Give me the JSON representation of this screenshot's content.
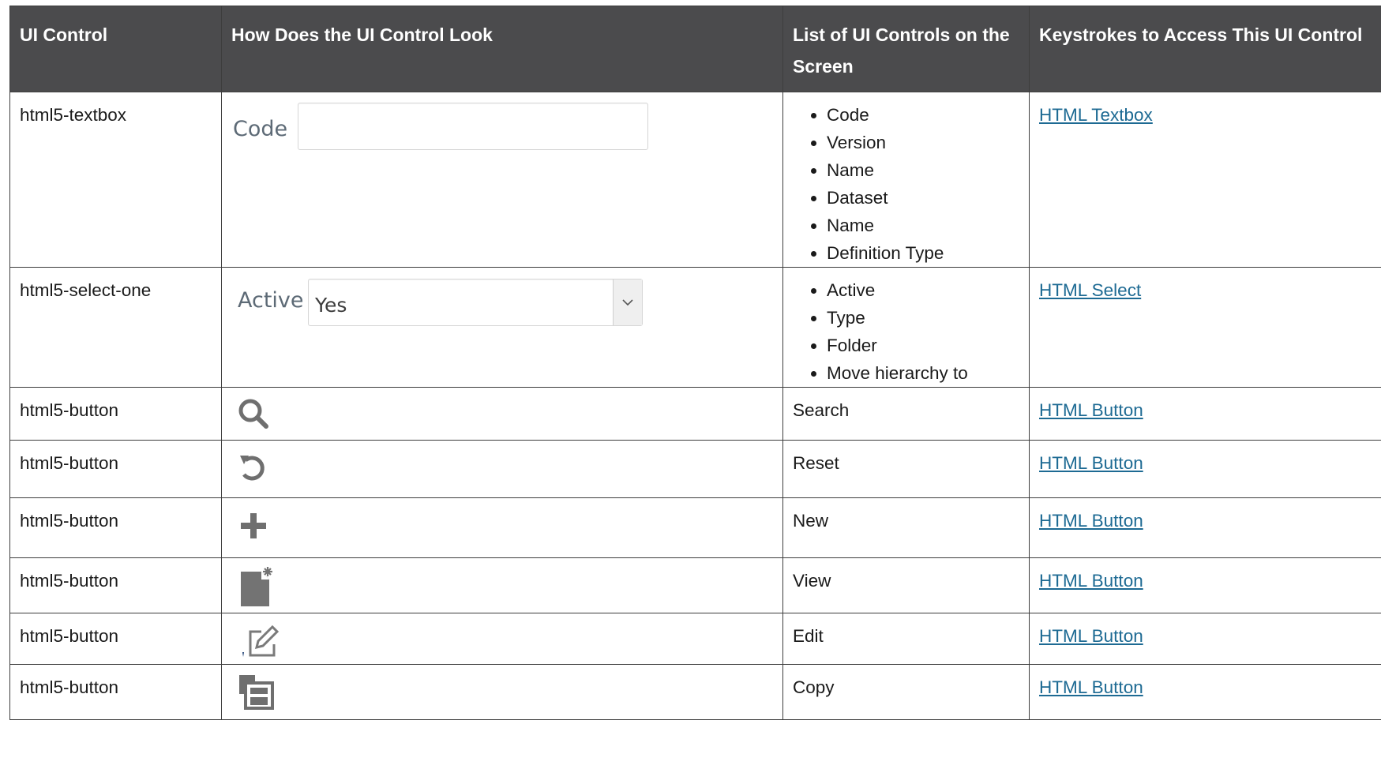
{
  "headers": {
    "ui_control": "UI Control",
    "looks": "How Does the UI Control Look",
    "controls_list": "List of UI Controls on the Screen",
    "keystrokes": "Keystrokes to Access This UI Control"
  },
  "rows": [
    {
      "ui_control": "html5-textbox",
      "mock": {
        "label": "Code",
        "value": ""
      },
      "controls": [
        "Code",
        "Version",
        "Name",
        "Dataset",
        "Name",
        "Definition Type"
      ],
      "link": "HTML Textbox"
    },
    {
      "ui_control": "html5-select-one",
      "mock": {
        "label": "Active",
        "value": "Yes"
      },
      "controls": [
        "Active",
        "Type",
        "Folder",
        "Move hierarchy to"
      ],
      "link": "HTML Select"
    },
    {
      "ui_control": "html5-button",
      "icon": "search-icon",
      "control_text": "Search",
      "link": "HTML Button"
    },
    {
      "ui_control": "html5-button",
      "icon": "reset-icon",
      "control_text": "Reset",
      "link": "HTML Button"
    },
    {
      "ui_control": "html5-button",
      "icon": "plus-icon",
      "control_text": "New",
      "link": "HTML Button"
    },
    {
      "ui_control": "html5-button",
      "icon": "view-document-icon",
      "control_text": "View",
      "link": "HTML Button"
    },
    {
      "ui_control": "html5-button",
      "icon": "edit-icon",
      "control_text": "Edit",
      "link": "HTML Button"
    },
    {
      "ui_control": "html5-button",
      "icon": "copy-icon",
      "control_text": "Copy",
      "link": "HTML Button"
    }
  ],
  "colors": {
    "header_bg": "#4b4b4d",
    "link": "#1d6a93",
    "icon_gray": "#6f6f6f"
  }
}
